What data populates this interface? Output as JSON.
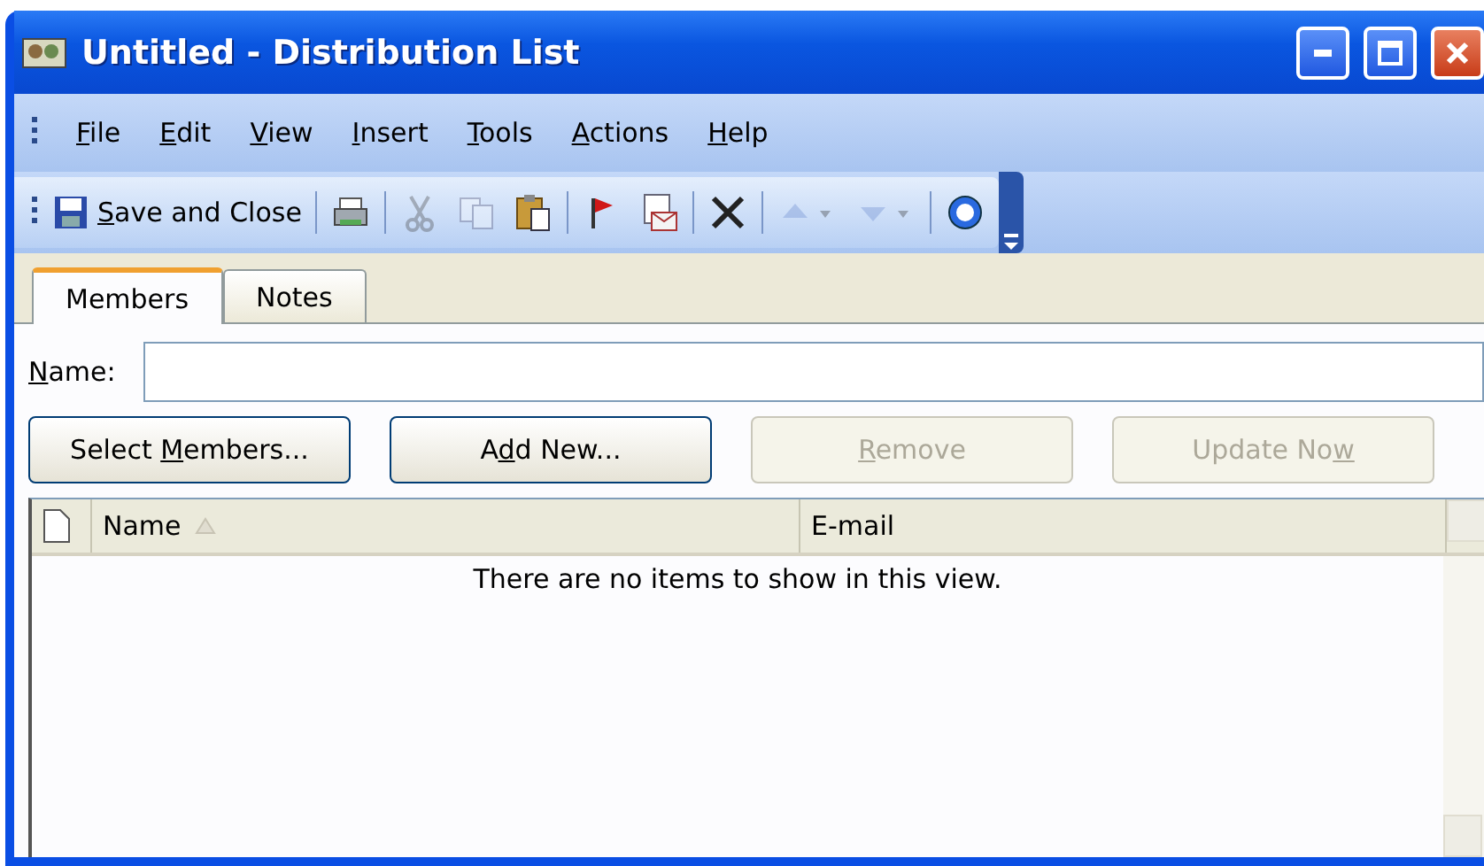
{
  "window": {
    "title": "Untitled - Distribution List"
  },
  "menu": [
    {
      "key": "F",
      "post": "ile"
    },
    {
      "key": "E",
      "post": "dit"
    },
    {
      "key": "V",
      "post": "iew"
    },
    {
      "key": "I",
      "post": "nsert"
    },
    {
      "key": "T",
      "post": "ools"
    },
    {
      "key": "A",
      "post": "ctions"
    },
    {
      "key": "H",
      "post": "elp"
    }
  ],
  "toolbar": [
    {
      "kind": "save-close",
      "key": "S",
      "post": "ave and Close",
      "disabled": false
    },
    {
      "kind": "separator"
    },
    {
      "kind": "print",
      "disabled": false
    },
    {
      "kind": "separator"
    },
    {
      "kind": "cut",
      "disabled": true
    },
    {
      "kind": "copy",
      "disabled": true
    },
    {
      "kind": "paste",
      "disabled": false
    },
    {
      "kind": "separator"
    },
    {
      "kind": "flag",
      "disabled": false
    },
    {
      "kind": "envelope",
      "disabled": false
    },
    {
      "kind": "separator"
    },
    {
      "kind": "delete",
      "disabled": false
    },
    {
      "kind": "separator"
    },
    {
      "kind": "up",
      "disabled": true
    },
    {
      "kind": "down",
      "disabled": true
    },
    {
      "kind": "separator"
    },
    {
      "kind": "help",
      "disabled": false
    }
  ],
  "tabs": [
    {
      "label": "Members",
      "selected": true
    },
    {
      "label": "Notes",
      "selected": false
    }
  ],
  "name_field": {
    "key": "N",
    "post": "ame:"
  },
  "buttons": [
    {
      "pre": "Select ",
      "key": "M",
      "post": "embers...",
      "disabled": false
    },
    {
      "pre": "A",
      "key": "d",
      "post": "d New...",
      "disabled": false
    },
    {
      "key": "R",
      "post": "emove",
      "disabled": true
    },
    {
      "pre": "Update No",
      "key": "w",
      "disabled": true
    }
  ],
  "table": {
    "columns": [
      {
        "label": "Name",
        "sorted": true
      },
      {
        "label": "E-mail",
        "sorted": false
      }
    ],
    "empty_message": "There are no items to show in this view."
  }
}
